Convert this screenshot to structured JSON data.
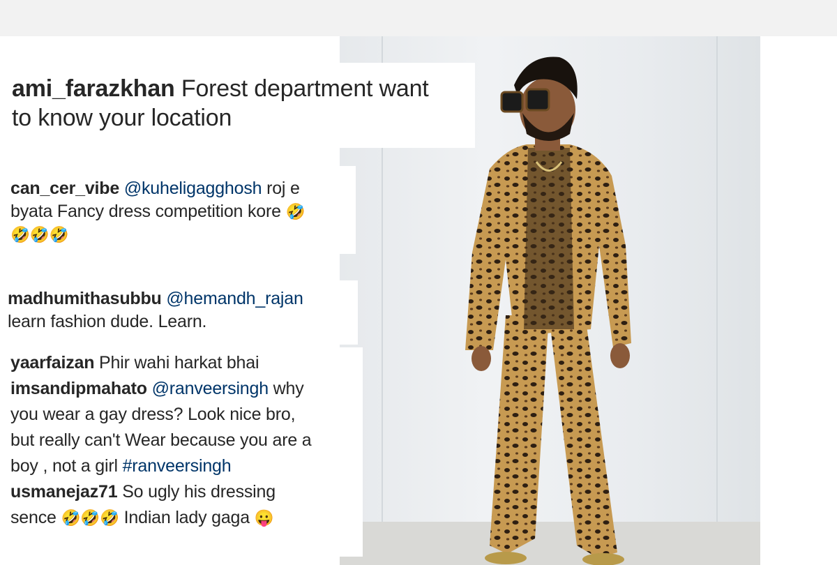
{
  "comments": [
    {
      "username": "ami_farazkhan",
      "text_line1": "Forest department want",
      "text_line2": "to know your location"
    },
    {
      "username": "can_cer_vibe",
      "mention": "@kuheligagghosh",
      "text_line1": "roj e",
      "text_line2": "byata Fancy dress competition kore",
      "emoji_a": "🤣",
      "emoji_b": "🤣🤣🤣"
    },
    {
      "username": "madhumithasubbu",
      "mention": "@hemandh_rajan",
      "text_line2": "learn fashion dude. Learn."
    },
    {
      "username": "yaarfaizan",
      "text_line1": "Phir wahi harkat bhai"
    },
    {
      "username": "imsandipmahato",
      "mention": "@ranveersingh",
      "text_line1": "why",
      "text_line2": "you wear a gay dress? Look nice bro,",
      "text_line3": "but really can't Wear because you are a",
      "text_line4": "boy , not a girl",
      "hashtag": "#ranveersingh"
    },
    {
      "username": "usmanejaz71",
      "text_line1": "So ugly his dressing",
      "text_line2a": "sence",
      "emoji_a": "🤣🤣🤣",
      "text_line2b": "Indian lady gaga",
      "emoji_b": "😛"
    }
  ],
  "photo": {
    "subject": "man in leopard print suit with sunglasses",
    "colors": {
      "wall": "#eceff1",
      "floor": "#d9d9d6",
      "suit": "#c79a52",
      "spots": "#2e1f12"
    }
  }
}
